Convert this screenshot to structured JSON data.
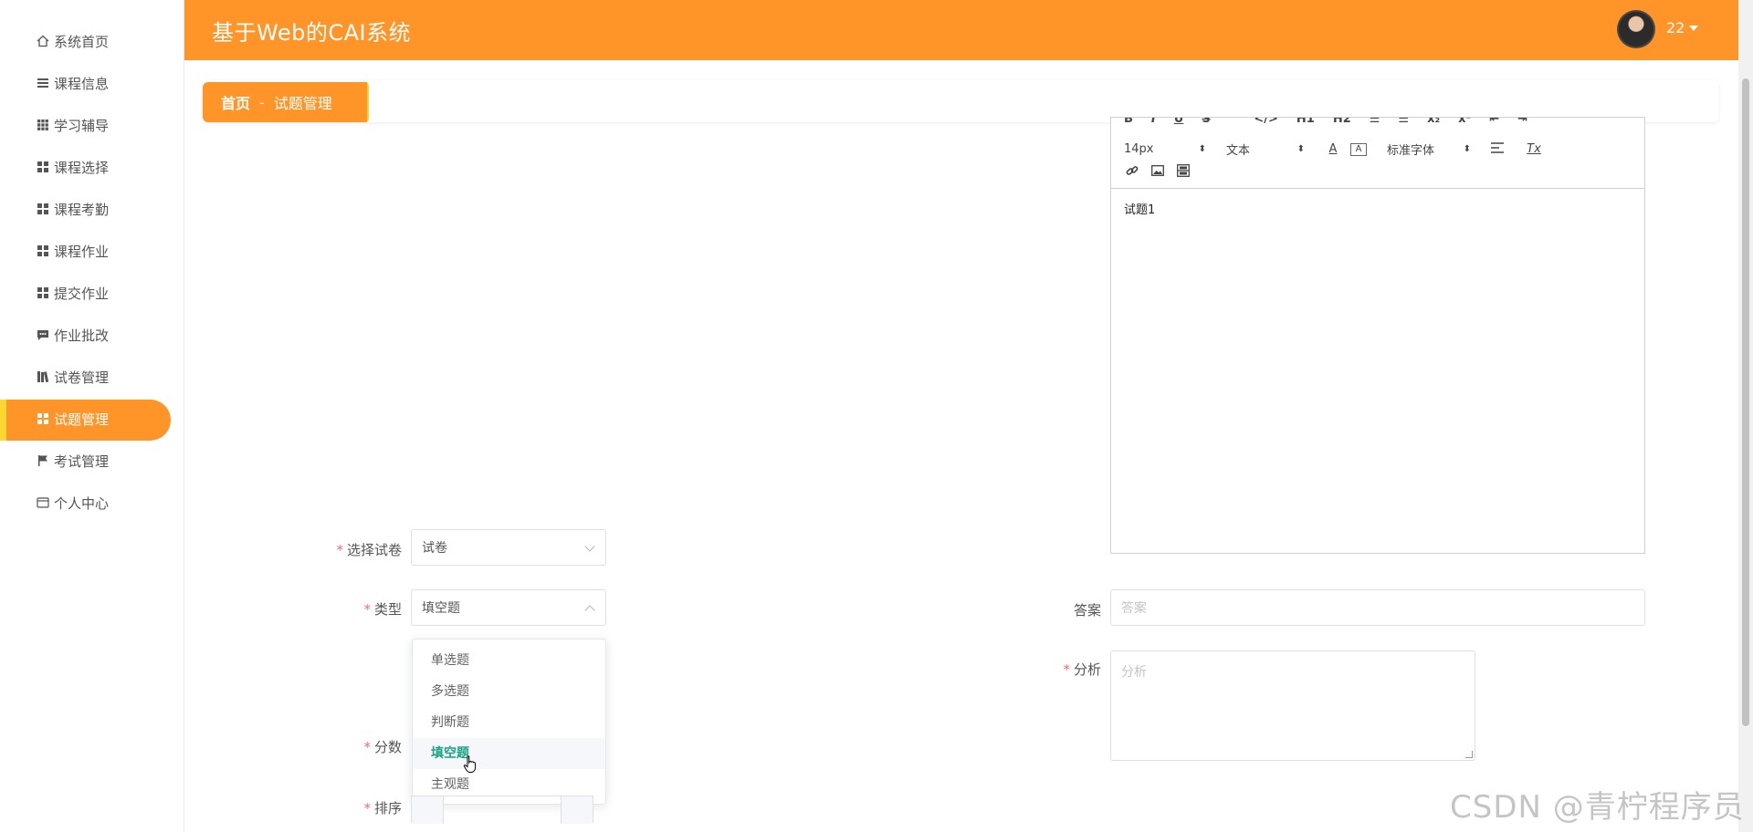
{
  "app": {
    "title": "基于Web的CAI系统"
  },
  "user": {
    "name": "22"
  },
  "sidebar": {
    "items": [
      {
        "label": "系统首页",
        "icon": "home-icon"
      },
      {
        "label": "课程信息",
        "icon": "list-icon"
      },
      {
        "label": "学习辅导",
        "icon": "grid-icon"
      },
      {
        "label": "课程选择",
        "icon": "apps-icon"
      },
      {
        "label": "课程考勤",
        "icon": "apps-icon"
      },
      {
        "label": "课程作业",
        "icon": "apps-icon"
      },
      {
        "label": "提交作业",
        "icon": "apps-icon"
      },
      {
        "label": "作业批改",
        "icon": "comment-icon"
      },
      {
        "label": "试卷管理",
        "icon": "books-icon"
      },
      {
        "label": "试题管理",
        "icon": "apps-icon",
        "active": true
      },
      {
        "label": "考试管理",
        "icon": "flag-icon"
      },
      {
        "label": "个人中心",
        "icon": "card-icon"
      }
    ]
  },
  "breadcrumb": {
    "home": "首页",
    "separator": "-",
    "current": "试题管理"
  },
  "editor": {
    "font_size": "14px",
    "block_format": "文本",
    "font_family": "标准字体",
    "content": "试题1"
  },
  "form": {
    "paper_label": "选择试卷",
    "paper_value": "试卷",
    "type_label": "类型",
    "type_value": "填空题",
    "type_options": [
      "单选题",
      "多选题",
      "判断题",
      "填空题",
      "主观题"
    ],
    "type_selected_index": 3,
    "score_label": "分数",
    "order_label": "排序",
    "answer_label": "答案",
    "answer_placeholder": "答案",
    "analysis_label": "分析",
    "analysis_placeholder": "分析"
  },
  "watermark": "CSDN @青柠程序员",
  "colors": {
    "primary": "#ff9528",
    "accent": "#ffd630",
    "selected_option": "#1aa386",
    "required": "#f56c6c"
  }
}
